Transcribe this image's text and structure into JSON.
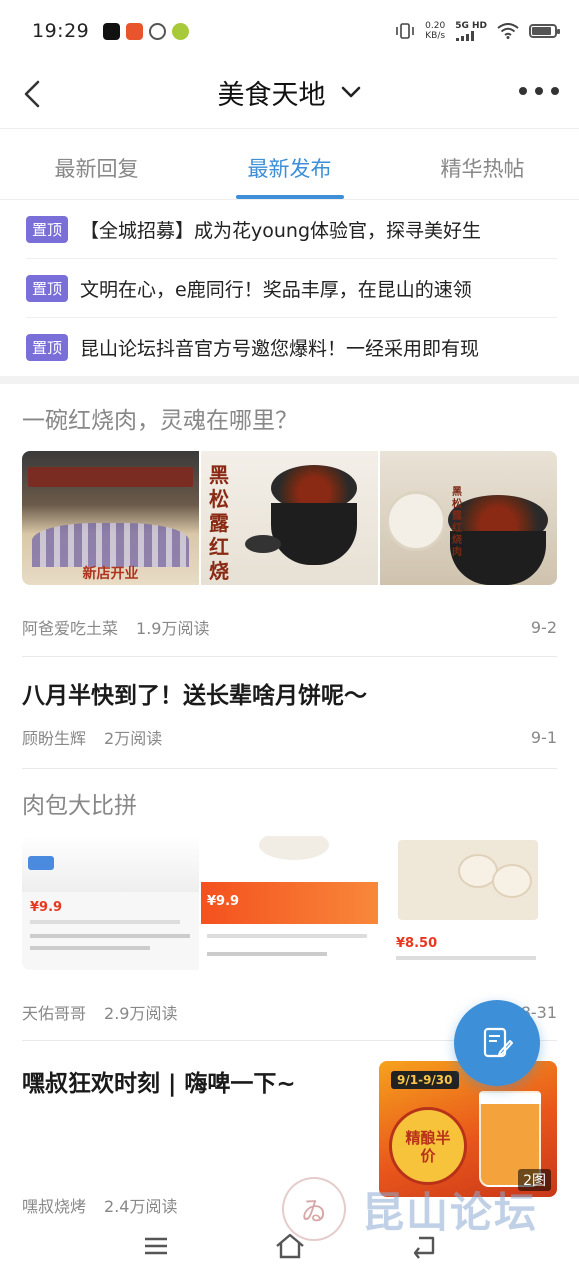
{
  "status_bar": {
    "time": "19:29",
    "net_speed_value": "0.20",
    "net_speed_unit": "KB/s",
    "network": "5G HD",
    "battery_level": 0.85
  },
  "header": {
    "title": "美食天地",
    "back_icon": "chevron-left-icon",
    "dropdown_icon": "chevron-down-icon",
    "more_icon": "more-dots-icon"
  },
  "tabs": [
    {
      "label": "最新回复",
      "active": false
    },
    {
      "label": "最新发布",
      "active": true
    },
    {
      "label": "精华热帖",
      "active": false
    }
  ],
  "pinned": [
    {
      "badge": "置顶",
      "text": "【全城招募】成为花young体验官，探寻美好生"
    },
    {
      "badge": "置顶",
      "text": "文明在心，e鹿同行！奖品丰厚，在昆山的速领"
    },
    {
      "badge": "置顶",
      "text": "昆山论坛抖音官方号邀您爆料！一经采用即有现"
    }
  ],
  "posts": [
    {
      "title": "一碗红烧肉，灵魂在哪里？",
      "author": "阿爸爱吃土菜",
      "reads": "1.9万阅读",
      "date": "9-2",
      "image_texts": [
        "新店开业",
        "黑松露红烧",
        "黑松露红烧肉"
      ]
    },
    {
      "title": "八月半快到了！送长辈啥月饼呢～",
      "author": "顾盼生辉",
      "reads": "2万阅读",
      "date": "9-1"
    },
    {
      "title": "肉包大比拼",
      "author": "天佑哥哥",
      "reads": "2.9万阅读",
      "date": "8-31",
      "image_texts": [
        "¥9.9",
        "¥9.9",
        "¥8.50"
      ]
    },
    {
      "title": "嘿叔狂欢时刻 | 嗨啤一下~",
      "author": "嘿叔烧烤",
      "reads": "2.4万阅读",
      "date": "",
      "image_count": "2图",
      "image_texts": [
        "9/1-9/30",
        "精酿半价"
      ]
    }
  ],
  "fab": {
    "icon": "edit-post-icon"
  },
  "bottom_nav": {
    "icons": [
      "menu-icon",
      "home-icon",
      "back-icon"
    ]
  },
  "watermark": {
    "text": "昆山论坛"
  },
  "colors": {
    "accent": "#3d8fd8",
    "pin_badge": "#7a6fd8",
    "muted": "#888888"
  }
}
